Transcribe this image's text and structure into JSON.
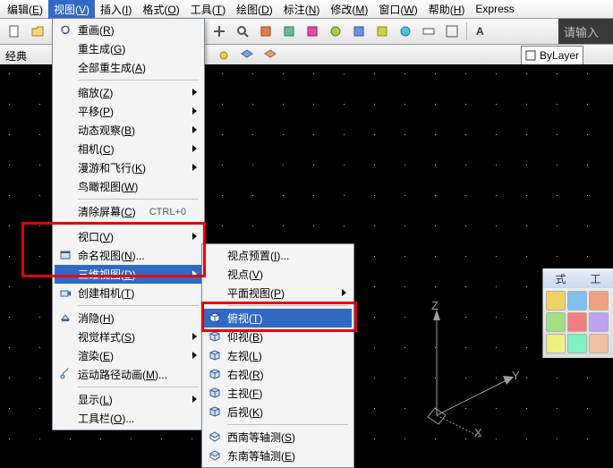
{
  "menubar": {
    "items": [
      {
        "label": "编辑",
        "key": "E"
      },
      {
        "label": "视图",
        "key": "V",
        "active": true
      },
      {
        "label": "插入",
        "key": "I"
      },
      {
        "label": "格式",
        "key": "O"
      },
      {
        "label": "工具",
        "key": "T"
      },
      {
        "label": "绘图",
        "key": "D"
      },
      {
        "label": "标注",
        "key": "N"
      },
      {
        "label": "修改",
        "key": "M"
      },
      {
        "label": "窗口",
        "key": "W"
      },
      {
        "label": "帮助",
        "key": "H"
      },
      {
        "label": "Express",
        "key": ""
      }
    ]
  },
  "search_placeholder": "请输入",
  "style_label": "经典",
  "layer_label": "ByLayer",
  "view_menu": [
    {
      "t": "item",
      "label": "重画(R)",
      "icon": "redraw"
    },
    {
      "t": "item",
      "label": "重生成(G)"
    },
    {
      "t": "item",
      "label": "全部重生成(A)"
    },
    {
      "t": "sep"
    },
    {
      "t": "item",
      "label": "缩放(Z)",
      "sub": true
    },
    {
      "t": "item",
      "label": "平移(P)",
      "sub": true
    },
    {
      "t": "item",
      "label": "动态观察(B)",
      "sub": true
    },
    {
      "t": "item",
      "label": "相机(C)",
      "sub": true
    },
    {
      "t": "item",
      "label": "漫游和飞行(K)",
      "sub": true
    },
    {
      "t": "item",
      "label": "鸟瞰视图(W)"
    },
    {
      "t": "sep"
    },
    {
      "t": "item",
      "label": "清除屏幕(C)",
      "shortcut": "CTRL+0"
    },
    {
      "t": "sep"
    },
    {
      "t": "item",
      "label": "视口(V)",
      "sub": true
    },
    {
      "t": "item",
      "label": "命名视图(N)...",
      "icon": "named"
    },
    {
      "t": "item",
      "label": "三维视图(D)",
      "sub": true,
      "hl": true
    },
    {
      "t": "item",
      "label": "创建相机(T)",
      "icon": "camera"
    },
    {
      "t": "sep"
    },
    {
      "t": "item",
      "label": "消隐(H)",
      "icon": "hide"
    },
    {
      "t": "item",
      "label": "视觉样式(S)",
      "sub": true
    },
    {
      "t": "item",
      "label": "渲染(E)",
      "sub": true
    },
    {
      "t": "item",
      "label": "运动路径动画(M)...",
      "icon": "anim"
    },
    {
      "t": "sep"
    },
    {
      "t": "item",
      "label": "显示(L)",
      "sub": true
    },
    {
      "t": "item",
      "label": "工具栏(O)..."
    }
  ],
  "sub_menu": [
    {
      "t": "item",
      "label": "视点预置(I)..."
    },
    {
      "t": "item",
      "label": "视点(V)"
    },
    {
      "t": "item",
      "label": "平面视图(P)",
      "sub": true
    },
    {
      "t": "sep"
    },
    {
      "t": "item",
      "label": "俯视(T)",
      "icon": "cube",
      "hl": true
    },
    {
      "t": "item",
      "label": "仰视(B)",
      "icon": "cube"
    },
    {
      "t": "item",
      "label": "左视(L)",
      "icon": "cube"
    },
    {
      "t": "item",
      "label": "右视(R)",
      "icon": "cube"
    },
    {
      "t": "item",
      "label": "主视(F)",
      "icon": "cube"
    },
    {
      "t": "item",
      "label": "后视(K)",
      "icon": "cube"
    },
    {
      "t": "sep"
    },
    {
      "t": "item",
      "label": "西南等轴测(S)",
      "icon": "iso"
    },
    {
      "t": "item",
      "label": "东南等轴测(E)",
      "icon": "iso"
    }
  ],
  "axis": {
    "z": "Z",
    "y": "Y",
    "x": "X"
  },
  "rpanel": {
    "tabs": [
      "式",
      "工"
    ]
  }
}
